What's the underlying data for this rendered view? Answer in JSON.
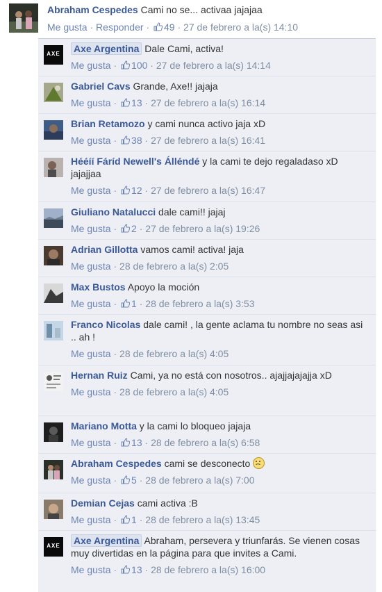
{
  "colors": {
    "link": "#3b5998",
    "meta": "#7f8ea3",
    "reply_bg": "#edeff4",
    "axe_logo": "#0a0a0a"
  },
  "main_comment": {
    "author": "Abraham Cespedes",
    "text": "Cami no se... activaa jajajaa",
    "like_label": "Me gusta",
    "reply_label": "Responder",
    "likes": "49",
    "timestamp": "27 de febrero a la(s) 14:10"
  },
  "replies": [
    {
      "author": "Axe Argentina",
      "text": "Dale Cami, activa!",
      "like_label": "Me gusta",
      "likes": "100",
      "timestamp": "27 de febrero a la(s) 14:14"
    },
    {
      "author": "Gabriel Cavs",
      "text": "Grande, Axe!! jajaja",
      "like_label": "Me gusta",
      "likes": "13",
      "timestamp": "27 de febrero a la(s) 16:14"
    },
    {
      "author": "Brian Retamozo",
      "text": "y cami nunca activo jaja xD",
      "like_label": "Me gusta",
      "likes": "38",
      "timestamp": "27 de febrero a la(s) 16:41"
    },
    {
      "author": "Hééíí Fáríd Newell's Álléndé",
      "text": "y la cami te dejo regaladaso xD jajajjaa",
      "like_label": "Me gusta",
      "likes": "12",
      "timestamp": "27 de febrero a la(s) 16:47"
    },
    {
      "author": "Giuliano Natalucci",
      "text": "dale cami!! jajaj",
      "like_label": "Me gusta",
      "likes": "2",
      "timestamp": "27 de febrero a la(s) 19:26"
    },
    {
      "author": "Adrian Gillotta",
      "text": "vamos cami! activa! jaja",
      "like_label": "Me gusta",
      "likes": "",
      "timestamp": "28 de febrero a la(s) 2:05"
    },
    {
      "author": "Max Bustos",
      "text": "Apoyo la moción",
      "like_label": "Me gusta",
      "likes": "1",
      "timestamp": "28 de febrero a la(s) 3:53"
    },
    {
      "author": "Franco Nicolas",
      "text": "dale cami! , la gente aclama tu nombre no seas asi .. ah !",
      "like_label": "Me gusta",
      "likes": "",
      "timestamp": "28 de febrero a la(s) 4:05"
    },
    {
      "author": "Hernan Ruiz",
      "text": "Cami, ya no está con nosotros.. ajajjajajajja xD",
      "like_label": "Me gusta",
      "likes": "",
      "timestamp": "28 de febrero a la(s) 4:05"
    },
    {
      "author": "Mariano Motta",
      "text": "y la cami lo bloqueo jajaja",
      "like_label": "Me gusta",
      "likes": "13",
      "timestamp": "28 de febrero a la(s) 6:58"
    },
    {
      "author": "Abraham Cespedes",
      "text": "cami se desconecto",
      "like_label": "Me gusta",
      "likes": "5",
      "timestamp": "28 de febrero a la(s) 7:00"
    },
    {
      "author": "Demian Cejas",
      "text": "cami activa :B",
      "like_label": "Me gusta",
      "likes": "1",
      "timestamp": "28 de febrero a la(s) 13:45"
    },
    {
      "author": "Axe Argentina",
      "text": "Abraham, persevera y triunfarás. Se vienen cosas muy divertidas en la página para que invites a Cami.",
      "like_label": "Me gusta",
      "likes": "13",
      "timestamp": "28 de febrero a la(s) 16:00"
    }
  ],
  "axe_logo_text": "AXE"
}
